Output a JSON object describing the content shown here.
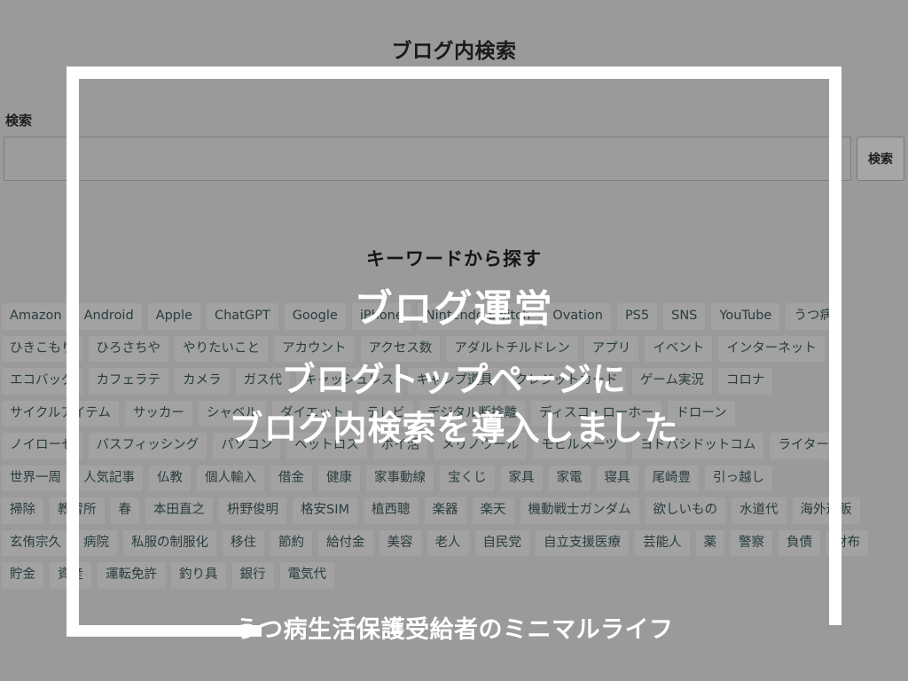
{
  "page": {
    "title": "ブログ内検索",
    "search": {
      "label": "検索",
      "value": "",
      "placeholder": "",
      "button_label": "検索"
    },
    "keyword_heading": "キーワードから探す",
    "tag_rows": [
      [
        "Amazon",
        "Android",
        "Apple",
        "ChatGPT",
        "Google",
        "iPhone",
        "Nintendo Switch",
        "Ovation",
        "PS5",
        "SNS",
        "YouTube",
        "うつ病"
      ],
      [
        "ひきこもり",
        "ひろさちや",
        "やりたいこと",
        "アカウント",
        "アクセス数",
        "アダルトチルドレン",
        "アプリ",
        "イベント",
        "インターネット"
      ],
      [
        "エコバッグ",
        "カフェラテ",
        "カメラ",
        "ガス代",
        "キャッシュレス",
        "キャンプ道具",
        "クレジットカード",
        "ゲーム実況",
        "コロナ"
      ],
      [
        "サイクルアイテム",
        "サッカー",
        "シャベル",
        "ダイエット",
        "テレビ",
        "デジタル断捨離",
        "ディスコ・ローホー",
        "ドローン"
      ],
      [
        "ノイローゼ",
        "バスフィッシング",
        "パソコン",
        "ペットロス",
        "ポイ活",
        "メリノウール",
        "モビルスーツ",
        "ヨドバシドットコム",
        "ライター"
      ],
      [
        "世界一周",
        "人気記事",
        "仏教",
        "個人輸入",
        "借金",
        "健康",
        "家事動線",
        "宝くじ",
        "家具",
        "家電",
        "寝具",
        "尾崎豊",
        "引っ越し"
      ],
      [
        "掃除",
        "教習所",
        "春",
        "本田直之",
        "枡野俊明",
        "格安SIM",
        "植西聰",
        "楽器",
        "楽天",
        "機動戦士ガンダム",
        "欲しいもの",
        "水道代",
        "海外通販"
      ],
      [
        "玄侑宗久",
        "病院",
        "私服の制服化",
        "移住",
        "節約",
        "給付金",
        "美容",
        "老人",
        "自民党",
        "自立支援医療",
        "芸能人",
        "薬",
        "警察",
        "負債",
        "財布"
      ],
      [
        "貯金",
        "資産",
        "運転免許",
        "釣り具",
        "銀行",
        "電気代"
      ]
    ]
  },
  "overlay": {
    "kicker": "ブログ運営",
    "line1": "ブログトップページに",
    "line2": "ブログ内検索を導入しました",
    "footer": "うつ病生活保護受給者のミニマルライフ"
  },
  "colors": {
    "background": "#9a9a9a",
    "overlay_white": "#ffffff",
    "tag_background": "#a2a2a2",
    "tag_text": "#2a3c3c"
  }
}
